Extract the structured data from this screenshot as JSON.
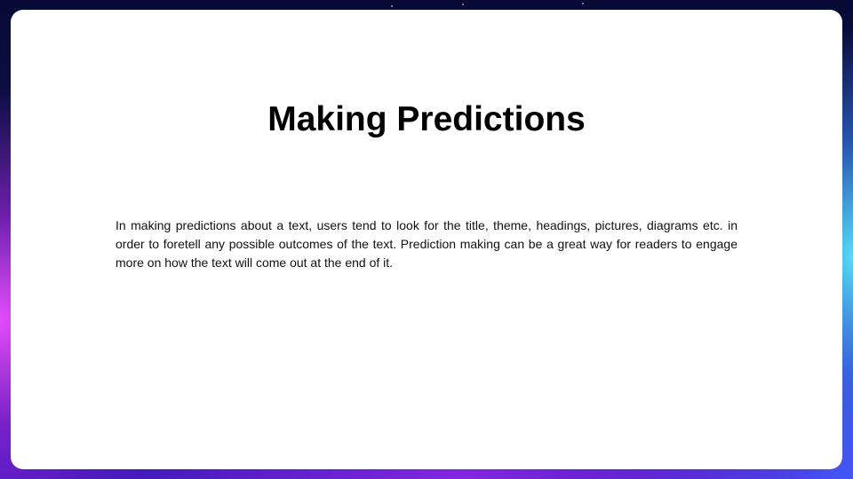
{
  "slide": {
    "title": "Making Predictions",
    "body": "In making predictions about a text, users tend to look for the title, theme, headings, pictures, diagrams etc. in order to foretell any possible outcomes of the text. Prediction making can be a great way for readers to engage more on how the text will come out at the end of it."
  },
  "colors": {
    "card_background": "#ffffff",
    "text": "#000000",
    "frame_top": "#080a35",
    "frame_left_glow": "#ec50ff",
    "frame_right_glow": "#5ae6ff",
    "frame_bottom": "#3a18b8"
  }
}
